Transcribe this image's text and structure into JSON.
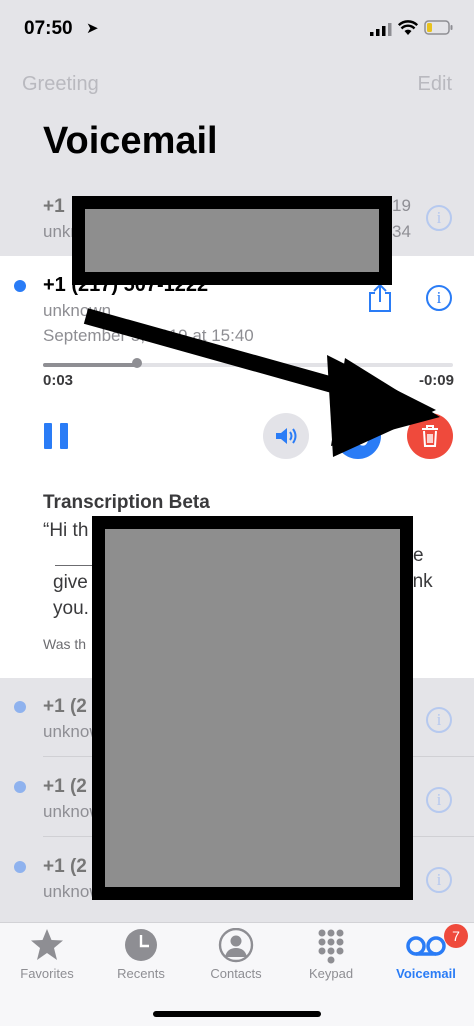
{
  "status_bar": {
    "time": "07:50",
    "location_glyph": "➤"
  },
  "header": {
    "greeting_label": "Greeting",
    "edit_label": "Edit",
    "title": "Voicemail"
  },
  "top_row": {
    "title": "+1",
    "subtitle": "unkn",
    "date_suffix": "19",
    "time_suffix": "34"
  },
  "expanded": {
    "title": "+1 (217) 507-1222",
    "subtitle": "unknown",
    "date": "September 5, 2019 at 15:40",
    "elapsed": "0:03",
    "remaining": "-0:09",
    "progress": 0.23,
    "transcription_header": "Transcription Beta",
    "transcription_start": "“Hi th",
    "transcription_line2": "give",
    "transcription_line3": "you.",
    "transcription_right1": "e",
    "transcription_right2": "ank",
    "feedback_prompt": "Was th"
  },
  "list": [
    {
      "title": "+1 (2",
      "subtitle": "unknow"
    },
    {
      "title": "+1 (2",
      "subtitle": "unknow"
    },
    {
      "title": "+1 (2",
      "subtitle": "unknow"
    }
  ],
  "tabs": [
    {
      "label": "Favorites",
      "icon": "star-icon"
    },
    {
      "label": "Recents",
      "icon": "clock-icon"
    },
    {
      "label": "Contacts",
      "icon": "person-icon"
    },
    {
      "label": "Keypad",
      "icon": "keypad-icon"
    },
    {
      "label": "Voicemail",
      "icon": "voicemail-icon",
      "badge": "7",
      "active": true
    }
  ],
  "colors": {
    "accent": "#2a7cf6",
    "delete": "#ef4a3c",
    "gray_bg": "#e4e4e8"
  }
}
